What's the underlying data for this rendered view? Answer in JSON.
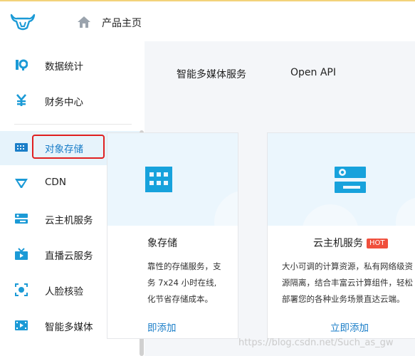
{
  "header": {
    "title": "产品主页",
    "logo_icon": "bull-logo",
    "home_icon": "home-icon"
  },
  "sidebar": {
    "items": [
      {
        "label": "数据统计",
        "icon": "analytics-icon"
      },
      {
        "label": "财务中心",
        "icon": "yen-icon"
      },
      {
        "label": "对象存储",
        "icon": "storage-grid-icon",
        "active": true
      },
      {
        "label": "CDN",
        "icon": "cdn-funnel-icon"
      },
      {
        "label": "云主机服务",
        "icon": "server-icon"
      },
      {
        "label": "直播云服务",
        "icon": "live-tv-icon"
      },
      {
        "label": "人脸核验",
        "icon": "face-icon"
      },
      {
        "label": "智能多媒体",
        "icon": "media-icon"
      }
    ]
  },
  "tabs": [
    "智能多媒体服务",
    "Open API"
  ],
  "cards": [
    {
      "title": "象存储",
      "desc": [
        "靠性的存储服务，支",
        "务 7x24 小时在线,",
        "化节省存储成本。"
      ],
      "button": "即添加"
    },
    {
      "title": "云主机服务",
      "badge": "HOT",
      "desc": [
        "大小可调的计算资源，私有网络级资",
        "源隔离，结合丰富云计算组件，轻松",
        "部署您的各种业务场景直达云端。"
      ],
      "button": "立即添加"
    }
  ],
  "watermark": "https://blog.csdn.net/Such_as_gw",
  "colors": {
    "accent": "#1b7ec8",
    "active_bg": "#e6f3fb",
    "highlight": "#e02020",
    "hot": "#f04f3c"
  }
}
